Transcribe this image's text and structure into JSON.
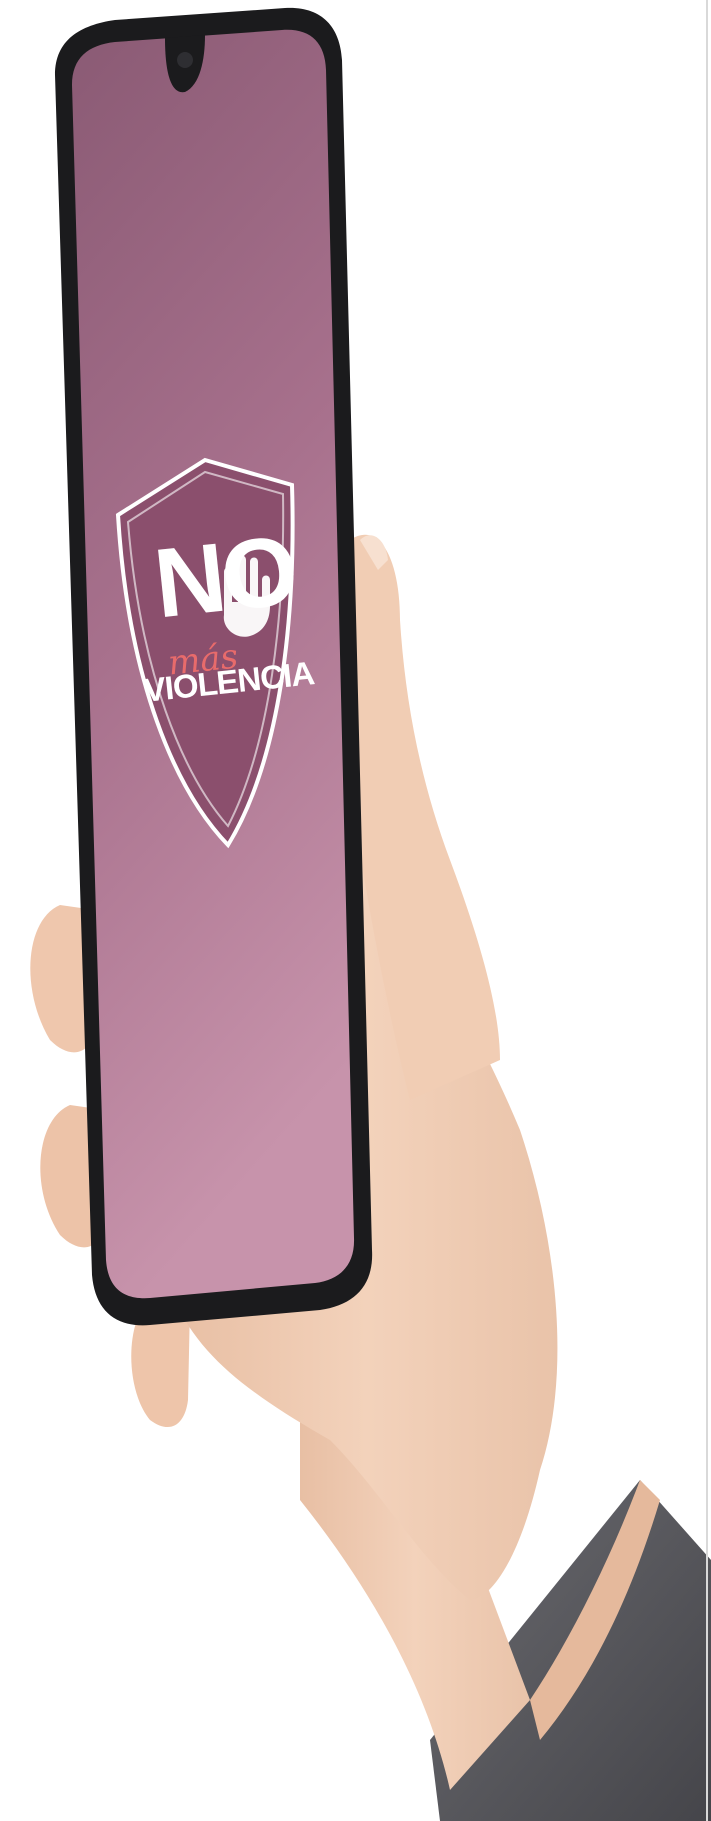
{
  "scene": {
    "description_colors": {
      "background": "#ffffff",
      "phone_body": "#1d1d1f",
      "screen_top": "#8a5a74",
      "screen_bottom": "#c48ea6",
      "shield_fill": "#8b4f6d",
      "skin": "#efcab1",
      "sleeve": "#5a5a5e"
    }
  },
  "logo": {
    "no_text": "NO",
    "mas_text": "más",
    "violencia_text": "VIOLENCIA"
  }
}
